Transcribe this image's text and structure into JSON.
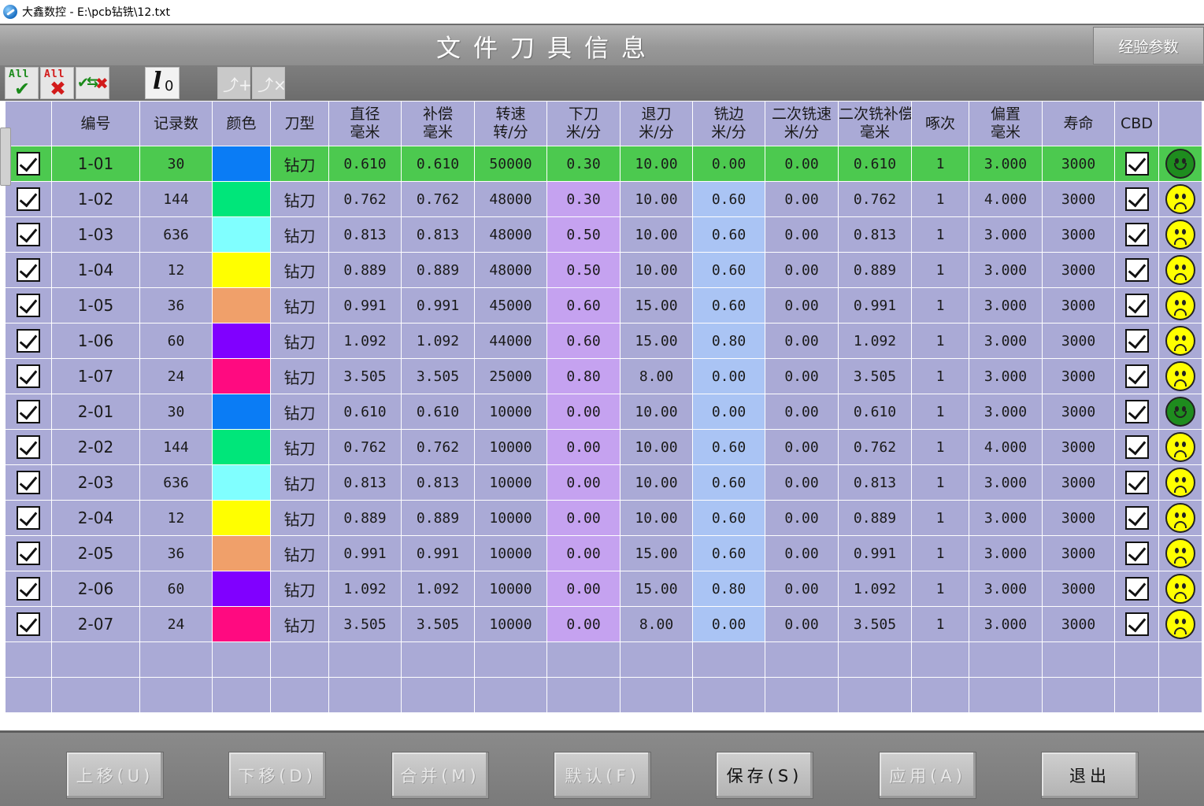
{
  "window": {
    "title": "大鑫数控 - E:\\pcb钻铣\\12.txt"
  },
  "header": {
    "title": "文件刀具信息",
    "experience_button": "经验参数"
  },
  "toolbar": {
    "select_all_label": "All",
    "deselect_all_label": "All",
    "tool_zero_label": "0",
    "icons": [
      "select-all-icon",
      "deselect-all-icon",
      "invert-selection-icon",
      "tool-zero-icon",
      "add-tool-icon",
      "delete-tool-icon"
    ]
  },
  "table": {
    "headers": {
      "id": "编号",
      "count": "记录数",
      "color": "颜色",
      "type": "刀型",
      "diameter": [
        "直径",
        "毫米"
      ],
      "comp": [
        "补偿",
        "毫米"
      ],
      "speed": [
        "转速",
        "转/分"
      ],
      "feed": [
        "下刀",
        "米/分"
      ],
      "retract": [
        "退刀",
        "米/分"
      ],
      "mill": [
        "铣边",
        "米/分"
      ],
      "mill2speed": [
        "二次铣速",
        "米/分"
      ],
      "mill2comp": [
        "二次铣补偿",
        "毫米"
      ],
      "peck": "啄次",
      "offset": [
        "偏置",
        "毫米"
      ],
      "life": "寿命",
      "cbd": "CBD"
    },
    "rows": [
      {
        "id": "1-01",
        "count": "30",
        "color": "#0a7cf5",
        "type": "钻刀",
        "diameter": "0.610",
        "comp": "0.610",
        "speed": "50000",
        "feed": "0.30",
        "retract": "10.00",
        "mill": "0.00",
        "mill2speed": "0.00",
        "mill2comp": "0.610",
        "peck": "1",
        "offset": "3.000",
        "life": "3000",
        "status": "happy",
        "selected": true
      },
      {
        "id": "1-02",
        "count": "144",
        "color": "#00e67a",
        "type": "钻刀",
        "diameter": "0.762",
        "comp": "0.762",
        "speed": "48000",
        "feed": "0.30",
        "retract": "10.00",
        "mill": "0.60",
        "mill2speed": "0.00",
        "mill2comp": "0.762",
        "peck": "1",
        "offset": "4.000",
        "life": "3000",
        "status": "sad",
        "selected": false
      },
      {
        "id": "1-03",
        "count": "636",
        "color": "#80ffff",
        "type": "钻刀",
        "diameter": "0.813",
        "comp": "0.813",
        "speed": "48000",
        "feed": "0.50",
        "retract": "10.00",
        "mill": "0.60",
        "mill2speed": "0.00",
        "mill2comp": "0.813",
        "peck": "1",
        "offset": "3.000",
        "life": "3000",
        "status": "sad",
        "selected": false
      },
      {
        "id": "1-04",
        "count": "12",
        "color": "#ffff00",
        "type": "钻刀",
        "diameter": "0.889",
        "comp": "0.889",
        "speed": "48000",
        "feed": "0.50",
        "retract": "10.00",
        "mill": "0.60",
        "mill2speed": "0.00",
        "mill2comp": "0.889",
        "peck": "1",
        "offset": "3.000",
        "life": "3000",
        "status": "sad",
        "selected": false
      },
      {
        "id": "1-05",
        "count": "36",
        "color": "#f0a06a",
        "type": "钻刀",
        "diameter": "0.991",
        "comp": "0.991",
        "speed": "45000",
        "feed": "0.60",
        "retract": "15.00",
        "mill": "0.60",
        "mill2speed": "0.00",
        "mill2comp": "0.991",
        "peck": "1",
        "offset": "3.000",
        "life": "3000",
        "status": "sad",
        "selected": false
      },
      {
        "id": "1-06",
        "count": "60",
        "color": "#8000ff",
        "type": "钻刀",
        "diameter": "1.092",
        "comp": "1.092",
        "speed": "44000",
        "feed": "0.60",
        "retract": "15.00",
        "mill": "0.80",
        "mill2speed": "0.00",
        "mill2comp": "1.092",
        "peck": "1",
        "offset": "3.000",
        "life": "3000",
        "status": "sad",
        "selected": false
      },
      {
        "id": "1-07",
        "count": "24",
        "color": "#ff0a80",
        "type": "钻刀",
        "diameter": "3.505",
        "comp": "3.505",
        "speed": "25000",
        "feed": "0.80",
        "retract": "8.00",
        "mill": "0.00",
        "mill2speed": "0.00",
        "mill2comp": "3.505",
        "peck": "1",
        "offset": "3.000",
        "life": "3000",
        "status": "sad",
        "selected": false
      },
      {
        "id": "2-01",
        "count": "30",
        "color": "#0a7cf5",
        "type": "钻刀",
        "diameter": "0.610",
        "comp": "0.610",
        "speed": "10000",
        "feed": "0.00",
        "retract": "10.00",
        "mill": "0.00",
        "mill2speed": "0.00",
        "mill2comp": "0.610",
        "peck": "1",
        "offset": "3.000",
        "life": "3000",
        "status": "happy",
        "selected": false
      },
      {
        "id": "2-02",
        "count": "144",
        "color": "#00e67a",
        "type": "钻刀",
        "diameter": "0.762",
        "comp": "0.762",
        "speed": "10000",
        "feed": "0.00",
        "retract": "10.00",
        "mill": "0.60",
        "mill2speed": "0.00",
        "mill2comp": "0.762",
        "peck": "1",
        "offset": "4.000",
        "life": "3000",
        "status": "sad",
        "selected": false
      },
      {
        "id": "2-03",
        "count": "636",
        "color": "#80ffff",
        "type": "钻刀",
        "diameter": "0.813",
        "comp": "0.813",
        "speed": "10000",
        "feed": "0.00",
        "retract": "10.00",
        "mill": "0.60",
        "mill2speed": "0.00",
        "mill2comp": "0.813",
        "peck": "1",
        "offset": "3.000",
        "life": "3000",
        "status": "sad",
        "selected": false
      },
      {
        "id": "2-04",
        "count": "12",
        "color": "#ffff00",
        "type": "钻刀",
        "diameter": "0.889",
        "comp": "0.889",
        "speed": "10000",
        "feed": "0.00",
        "retract": "10.00",
        "mill": "0.60",
        "mill2speed": "0.00",
        "mill2comp": "0.889",
        "peck": "1",
        "offset": "3.000",
        "life": "3000",
        "status": "sad",
        "selected": false
      },
      {
        "id": "2-05",
        "count": "36",
        "color": "#f0a06a",
        "type": "钻刀",
        "diameter": "0.991",
        "comp": "0.991",
        "speed": "10000",
        "feed": "0.00",
        "retract": "15.00",
        "mill": "0.60",
        "mill2speed": "0.00",
        "mill2comp": "0.991",
        "peck": "1",
        "offset": "3.000",
        "life": "3000",
        "status": "sad",
        "selected": false
      },
      {
        "id": "2-06",
        "count": "60",
        "color": "#8000ff",
        "type": "钻刀",
        "diameter": "1.092",
        "comp": "1.092",
        "speed": "10000",
        "feed": "0.00",
        "retract": "15.00",
        "mill": "0.80",
        "mill2speed": "0.00",
        "mill2comp": "1.092",
        "peck": "1",
        "offset": "3.000",
        "life": "3000",
        "status": "sad",
        "selected": false
      },
      {
        "id": "2-07",
        "count": "24",
        "color": "#ff0a80",
        "type": "钻刀",
        "diameter": "3.505",
        "comp": "3.505",
        "speed": "10000",
        "feed": "0.00",
        "retract": "8.00",
        "mill": "0.00",
        "mill2speed": "0.00",
        "mill2comp": "3.505",
        "peck": "1",
        "offset": "3.000",
        "life": "3000",
        "status": "sad",
        "selected": false
      }
    ],
    "empty_rows": 2
  },
  "status_colors": {
    "happy": "#1e8c1e",
    "sad": "#ffff00",
    "selected_row": "#4cc94f",
    "row_bg": "#aaaad6",
    "feed_col": "#c5a2f0",
    "mill_col": "#aac4f4"
  },
  "buttons": {
    "move_up": "上移(U)",
    "move_down": "下移(D)",
    "merge": "合并(M)",
    "default": "默认(F)",
    "save": "保存(S)",
    "apply": "应用(A)",
    "exit": "退出"
  }
}
